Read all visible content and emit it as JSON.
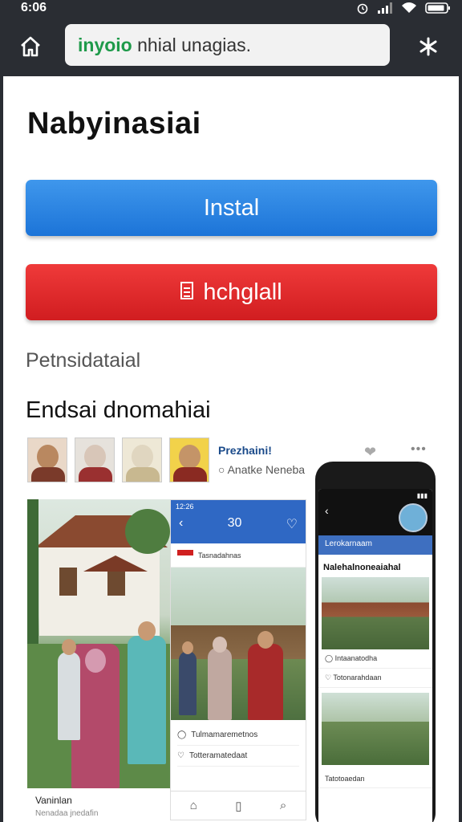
{
  "status": {
    "time": "6:06"
  },
  "urlbar": {
    "url_green": "inyoio",
    "url_rest": " nhial unagias."
  },
  "page": {
    "title": "Nabyinasiai",
    "install_label": "Instal",
    "second_label": "hchglall",
    "subtitle": "Petnsidataial",
    "section_title": "Endsai dnomahiai"
  },
  "card": {
    "name": "Prezhaini!",
    "meta": "Anatke Neneba"
  },
  "photo1": {
    "caption": "Vaninlan",
    "caption2": "Nenadaa jnedafin"
  },
  "screen1": {
    "status_time": "12:26",
    "nav_title": "30",
    "row_label": "Tasnadahnas",
    "foot_row1": "Tulmamaremetnos",
    "foot_row2": "Totteramatedaat"
  },
  "phone": {
    "blue_text": "Lerokarnaam",
    "heading": "Nalehalnoneaiahal",
    "row1": "Intaanatodha",
    "row2": "Totonarahdaan",
    "row3": "Tatotoaedan"
  },
  "colors": {
    "install": "#2b85e4",
    "second": "#e22a2c",
    "topbar": "#2a2d33"
  }
}
